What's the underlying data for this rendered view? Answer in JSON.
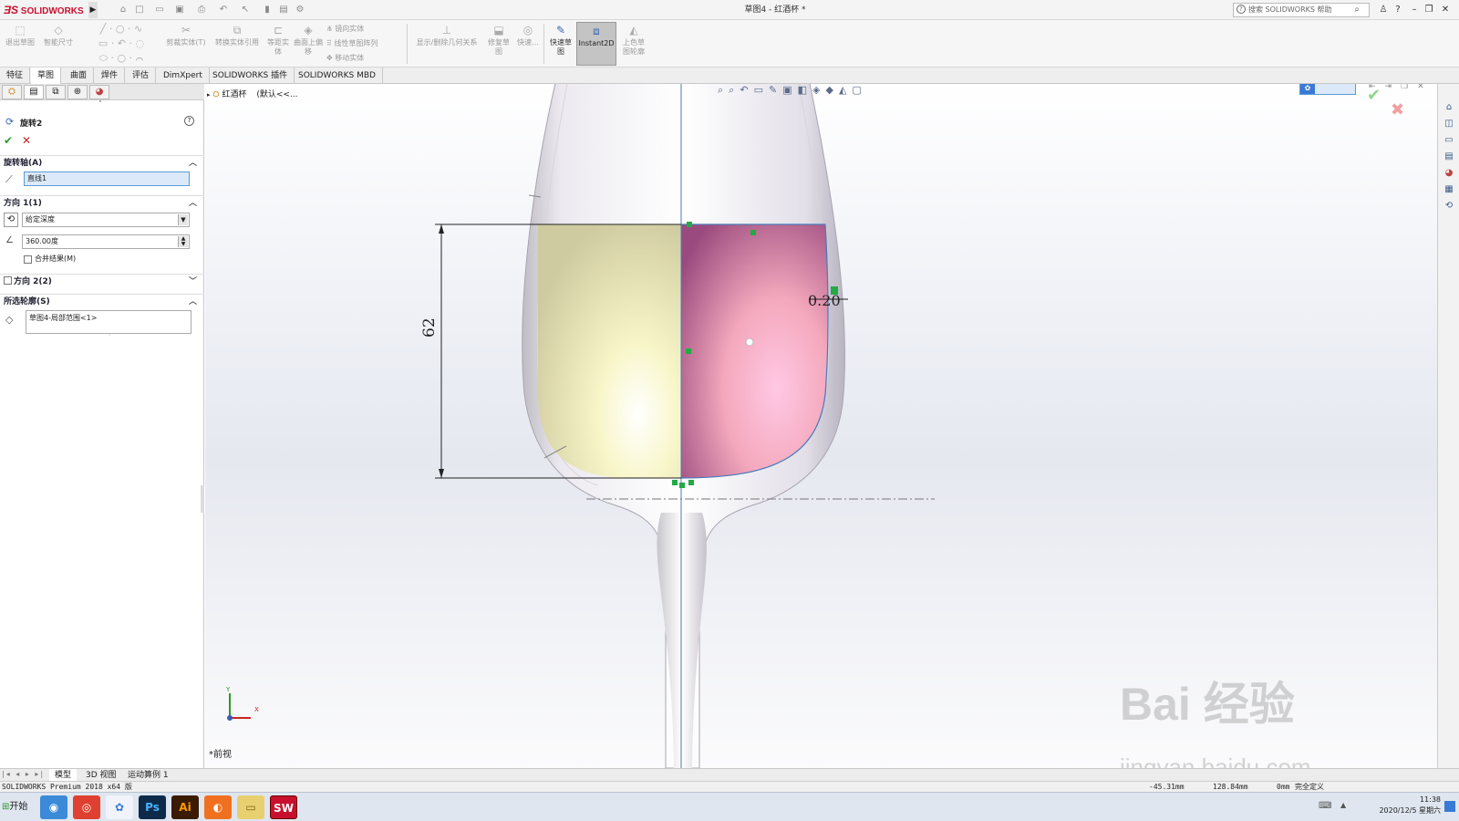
{
  "app": {
    "logo": "SOLIDWORKS",
    "document_title": "草图4 - 红酒杯 *",
    "help_search_placeholder": "搜索 SOLIDWORKS 帮助"
  },
  "command_manager": {
    "items": [
      {
        "label": "退出草图"
      },
      {
        "label": "智能尺寸"
      },
      {
        "label": "剪裁实体(T)"
      },
      {
        "label": "转换实体引用"
      },
      {
        "label": "等距实体"
      },
      {
        "label": "曲面上偏移"
      },
      {
        "label": "镜向实体"
      },
      {
        "label": "线性草图阵列"
      },
      {
        "label": "移动实体"
      },
      {
        "label": "显示/删除几何关系"
      },
      {
        "label": "修复草图"
      },
      {
        "label": "快速..."
      },
      {
        "label": "快速草图"
      },
      {
        "label": "Instant2D"
      },
      {
        "label": "上色草图轮廓"
      }
    ]
  },
  "tabs": [
    "特征",
    "草图",
    "曲面",
    "焊件",
    "评估",
    "DimXpert",
    "SOLIDWORKS 插件",
    "SOLIDWORKS MBD"
  ],
  "active_tab": "草图",
  "property_manager": {
    "title": "旋转2",
    "sections": {
      "axis_title": "旋转轴(A)",
      "axis_value": "直线1",
      "direction1_title": "方向 1(1)",
      "end_condition": "给定深度",
      "angle": "360.00度",
      "merge_label": "合并结果(M)",
      "direction2_title": "方向 2(2)",
      "contours_title": "所选轮廓(S)",
      "contours_value": "草图4-局部范围<1>"
    }
  },
  "feature_tree": {
    "root": "红酒杯",
    "config": "(默认<<..."
  },
  "viewport": {
    "dim_height": "62",
    "dim_thickness": "0.20",
    "view_name": "*前视",
    "axis_x": "X",
    "axis_y": "Y"
  },
  "bottom_tabs": [
    "模型",
    "3D 视图",
    "运动算例 1"
  ],
  "status": {
    "product": "SOLIDWORKS Premium 2018 x64 版",
    "x": "-45.31mm",
    "y": "128.84mm",
    "z": "0mm",
    "state": "完全定义"
  },
  "taskbar": {
    "start": "开始",
    "time": "11:38",
    "date": "2020/12/5 星期六"
  },
  "watermark": {
    "text": "Bai 经验",
    "url": "jingyan.baidu.com"
  },
  "colors": {
    "accent": "#c8102e",
    "wine_left": "#f4f0b8",
    "wine_right": "#f0a0c0",
    "sketch_green": "#22aa44"
  }
}
